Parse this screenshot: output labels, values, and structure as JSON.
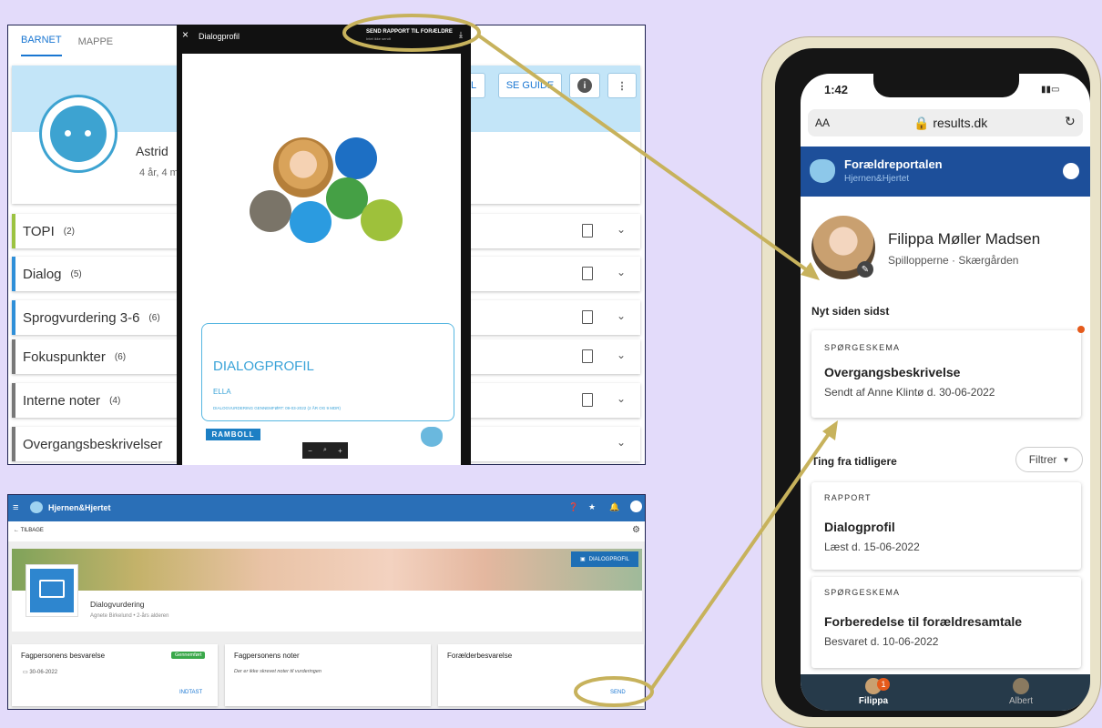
{
  "colors": {
    "accent_blue": "#1976d2",
    "navy": "#1d3f7a",
    "annot": "#c7b25c",
    "orange_dot": "#e55a1b",
    "green_badge": "#3aa84a"
  },
  "panel1": {
    "tabs": [
      "BARNET",
      "MAPPE"
    ],
    "buttons": {
      "se_guide": "SE GUIDE",
      "partial": "L"
    },
    "child": {
      "name": "Astrid",
      "age": "4 år, 4 m"
    },
    "rows": [
      {
        "label": "TOPI",
        "count": "(2)",
        "color": "#9cc341"
      },
      {
        "label": "Dialog",
        "count": "(5)",
        "color": "#2f8fd8"
      },
      {
        "label": "Sprogvurdering 3-6",
        "count": "(6)",
        "color": "#2f8fd8"
      },
      {
        "label": "Fokuspunkter",
        "count": "(6)",
        "color": "#777777"
      },
      {
        "label": "Interne noter",
        "count": "(4)",
        "color": "#777777"
      },
      {
        "label": "Overgangsbeskrivelser",
        "count": "",
        "color": "#777777"
      }
    ]
  },
  "viewer": {
    "close": "×",
    "title": "Dialogprofil",
    "send": "SEND RAPPORT TIL FORÆLDRE",
    "send_sub": "Intet ikke sendt",
    "doc_title": "DIALOGPROFIL",
    "doc_name": "ELLA",
    "doc_meta": "DIALOGVURDERING GENNEMFØRT: 09-03-2022 (2 ÅR OG 9 MDR)",
    "brand": "RAMBOLL",
    "zoom": [
      "−",
      "🔍",
      "+"
    ]
  },
  "panel2": {
    "brand": "Hjernen&Hjertet",
    "back": "TILBAGE",
    "dialogprofil_btn": "DIALOGPROFIL",
    "title": "Dialogvurdering",
    "meta": "Agnete Birkelund • 2-års alderen",
    "cards": [
      {
        "title": "Fagpersonens besvarelse",
        "badge": "Gennemført",
        "date": "30-06-2022",
        "action": "INDTAST"
      },
      {
        "title": "Fagpersonens noter",
        "note": "Der er ikke skrevet noter til vurderingen"
      },
      {
        "title": "Forælderbesvarelse",
        "action": "SEND"
      }
    ]
  },
  "phone": {
    "time": "1:42",
    "url": "results.dk",
    "aa": "AA",
    "app_title": "Forældreportalen",
    "app_sub": "Hjernen&Hjertet",
    "child_name": "Filippa Møller Madsen",
    "child_meta": "Spillopperne · Skærgården",
    "new_heading": "Nyt siden sidst",
    "new_card": {
      "cap": "SPØRGESKEMA",
      "title": "Overgangsbeskrivelse",
      "body": "Sendt af Anne Klintø d. 30-06-2022"
    },
    "earlier_heading": "Ting fra tidligere",
    "filter": "Filtrer",
    "earlier": [
      {
        "cap": "RAPPORT",
        "title": "Dialogprofil",
        "body": "Læst d. 15-06-2022"
      },
      {
        "cap": "SPØRGESKEMA",
        "title": "Forberedelse til forældresamtale",
        "body": "Besvaret d. 10-06-2022"
      }
    ],
    "tabs": [
      {
        "label": "Filippa",
        "badge": "1"
      },
      {
        "label": "Albert"
      }
    ]
  }
}
